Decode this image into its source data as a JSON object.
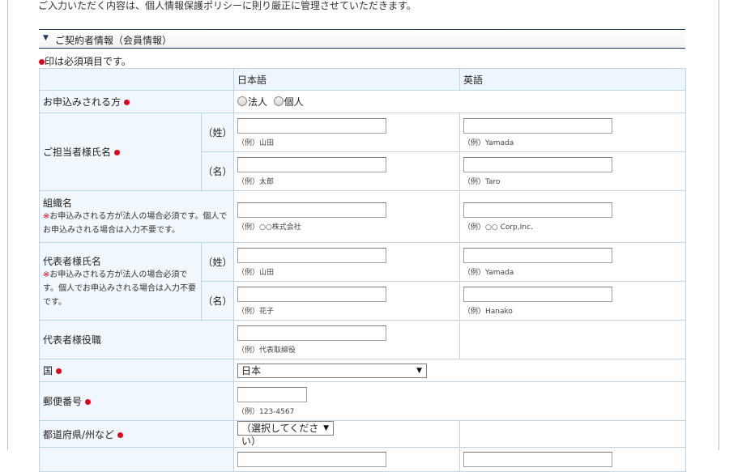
{
  "intro_text": "ご入力いただく内容は、個人情報保護ポリシーに則り厳正に管理させていただきます。",
  "section": {
    "toggle_icon": "triangle-down-icon",
    "title": "ご契約者情報（会員情報）"
  },
  "required_note": "印は必須項目です。",
  "colors": {
    "required_dot": "#e3001b",
    "border": "#c2d3e4",
    "label_bg": "#f0f7fd",
    "section_line": "#1f3a5a"
  },
  "table": {
    "header": {
      "japanese": "日本語",
      "english": "英語"
    },
    "applicant_type": {
      "label": "お申込みされる方",
      "option_corp": "法人",
      "option_individual": "個人"
    },
    "contact_name": {
      "label": "ご担当者様氏名",
      "last_label": "（姓）",
      "first_label": "（名）",
      "last_ex_ja": "（例）山田",
      "last_ex_en": "（例）Yamada",
      "first_ex_ja": "（例）太郎",
      "first_ex_en": "（例）Taro"
    },
    "organization": {
      "label": "組織名",
      "note_mark": "※",
      "note": "お申込みされる方が法人の場合必須です。個人でお申込みされる場合は入力不要です。",
      "ex_ja": "（例）○○株式会社",
      "ex_en": "（例）○○ Corp,Inc."
    },
    "representative_name": {
      "label": "代表者様氏名",
      "note_mark": "※",
      "note": "お申込みされる方が法人の場合必須です。個人でお申込みされる場合は入力不要です。",
      "last_label": "（姓）",
      "first_label": "（名）",
      "last_ex_ja": "（例）山田",
      "last_ex_en": "（例）Yamada",
      "first_ex_ja": "（例）花子",
      "first_ex_en": "（例）Hanako"
    },
    "representative_title": {
      "label": "代表者様役職",
      "ex_ja": "（例）代表取締役"
    },
    "country": {
      "label": "国",
      "selected": "日本"
    },
    "postal_code": {
      "label": "郵便番号",
      "ex": "（例）123-4567"
    },
    "prefecture": {
      "label": "都道府県/州など",
      "selected": "（選択してください）"
    }
  }
}
